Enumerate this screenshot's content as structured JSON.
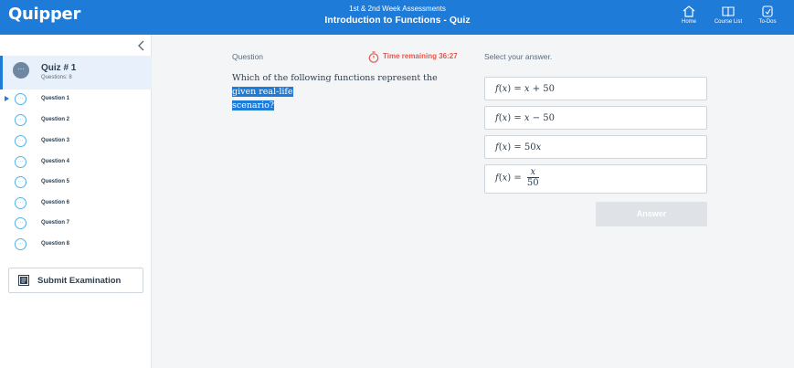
{
  "header": {
    "logo": "Quipper",
    "subtitle": "1st & 2nd Week Assessments",
    "title": "Introduction to Functions - Quiz",
    "nav": [
      {
        "label": "Home",
        "icon": "home-icon"
      },
      {
        "label": "Course List",
        "icon": "course-list-icon"
      },
      {
        "label": "To-Dos",
        "icon": "todo-icon"
      }
    ]
  },
  "sidebar": {
    "quiz_title": "Quiz # 1",
    "quiz_count": "Questions: 8",
    "quiz_badge": "···",
    "questions": [
      {
        "label": "Question 1",
        "active": true
      },
      {
        "label": "Question 2"
      },
      {
        "label": "Question 3"
      },
      {
        "label": "Question 4"
      },
      {
        "label": "Question 5"
      },
      {
        "label": "Question 6"
      },
      {
        "label": "Question 7"
      },
      {
        "label": "Question 8"
      }
    ],
    "dots": "···",
    "submit_label": "Submit Examination"
  },
  "question": {
    "header": "Question",
    "timer_label": "Time remaining 36:27",
    "text_plain": "Which of the following functions represent the ",
    "text_highlight_1": "given real-life",
    "text_highlight_2": "scenario?"
  },
  "answers": {
    "header": "Select your answer.",
    "options": [
      {
        "f": "f",
        "open": "(",
        "x": "x",
        "close": ")",
        "rest": " = ",
        "rhs_var": "x",
        "rhs": " + 50"
      },
      {
        "f": "f",
        "open": "(",
        "x": "x",
        "close": ")",
        "rest": " = ",
        "rhs_var": "x",
        "rhs": " − 50"
      },
      {
        "f": "f",
        "open": "(",
        "x": "x",
        "close": ")",
        "rest": " = 50",
        "rhs_var": "x",
        "rhs": ""
      },
      {
        "f": "f",
        "open": "(",
        "x": "x",
        "close": ")",
        "rest": " = ",
        "num": "x",
        "den": "50"
      }
    ],
    "submit_label": "Answer"
  },
  "colors": {
    "brand": "#1e7bd8",
    "timer": "#e8574a",
    "question_circle": "#4fb3e8"
  }
}
